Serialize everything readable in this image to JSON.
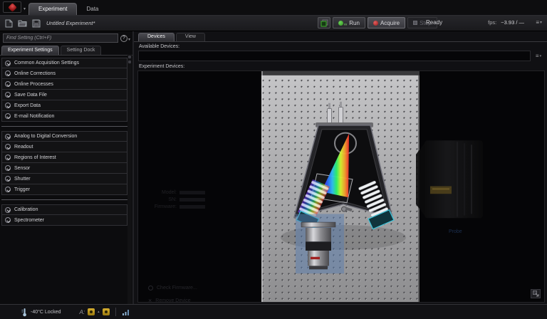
{
  "app": {
    "tabs": [
      {
        "label": "Experiment"
      },
      {
        "label": "Data"
      }
    ],
    "title": "Untitled Experiment*"
  },
  "toolbar": {
    "run": "Run",
    "acquire": "Acquire",
    "stop": "Stop",
    "status": "Ready",
    "fps_label": "fps:",
    "fps_value": "~3.93 / —",
    "menu_icon": "≡",
    "caret_icon": "▾",
    "infinity_icon": "∞"
  },
  "sidebar": {
    "search_placeholder": "Find Setting (Ctrl+F)",
    "help_icon": "?",
    "tabs": [
      "Experiment Settings",
      "Setting Dock"
    ],
    "groups": [
      {
        "items": [
          "Common Acquisition Settings",
          "Online Corrections",
          "Online Processes",
          "Save Data File",
          "Export Data",
          "E-mail Notification"
        ]
      },
      {
        "items": [
          "Analog to Digital Conversion",
          "Readout",
          "Regions of Interest",
          "Sensor",
          "Shutter",
          "Trigger"
        ]
      },
      {
        "items": [
          "Calibration",
          "Spectrometer"
        ]
      }
    ]
  },
  "devices": {
    "tabs": [
      "Devices",
      "View"
    ],
    "available_label": "Available Devices:",
    "experiment_label": "Experiment Devices:",
    "menu_icon": "≡",
    "caret_icon": "▾",
    "info_labels": {
      "model": "Model:",
      "sn": "SN:",
      "firmware": "Firmware:"
    },
    "actions": {
      "check_firmware": "Check Firmware...",
      "remove_device": "Remove Device",
      "remove_icon": "×"
    },
    "probe_label": "Probe"
  },
  "statusbar": {
    "temperature": "-40°C Locked",
    "icons": [
      "temperature-lock-icon",
      "annotation-a-icon",
      "warning-yellow-icon",
      "caret-up-icon",
      "warning-yellow-icon-2",
      "network-status-icon"
    ]
  },
  "colors": {
    "accent_green": "#3fae2a",
    "accent_red": "#c03030",
    "selection_blue": "#5a7eb0",
    "warning_yellow": "#c8a020"
  }
}
